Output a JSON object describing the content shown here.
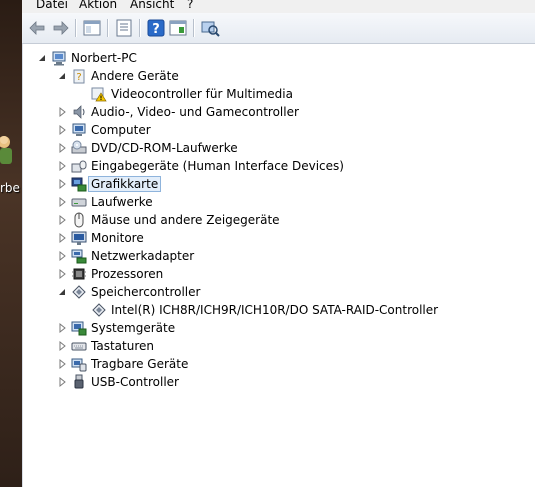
{
  "desktop": {
    "label": "rbe"
  },
  "menu": [
    "Datei",
    "Aktion",
    "Ansicht",
    "?"
  ],
  "toolbar": [
    "back-icon",
    "forward-icon",
    "show-hide-tree-icon",
    "properties-icon",
    "help-icon",
    "view-icon",
    "scan-hardware-icon"
  ],
  "tree": {
    "root": "Norbert-PC",
    "items": [
      {
        "label": "Andere Geräte",
        "icon": "unknown-device-icon",
        "expanded": true,
        "children": [
          {
            "label": "Videocontroller für Multimedia",
            "icon": "warning-device-icon"
          }
        ]
      },
      {
        "label": "Audio-, Video- und Gamecontroller",
        "icon": "speaker-icon"
      },
      {
        "label": "Computer",
        "icon": "computer-icon"
      },
      {
        "label": "DVD/CD-ROM-Laufwerke",
        "icon": "dvd-drive-icon"
      },
      {
        "label": "Eingabegeräte (Human Interface Devices)",
        "icon": "hid-icon"
      },
      {
        "label": "Grafikkarte",
        "icon": "display-adapter-icon",
        "selected": true
      },
      {
        "label": "Laufwerke",
        "icon": "disk-drive-icon"
      },
      {
        "label": "Mäuse und andere Zeigegeräte",
        "icon": "mouse-icon"
      },
      {
        "label": "Monitore",
        "icon": "monitor-icon"
      },
      {
        "label": "Netzwerkadapter",
        "icon": "network-adapter-icon"
      },
      {
        "label": "Prozessoren",
        "icon": "processor-icon"
      },
      {
        "label": "Speichercontroller",
        "icon": "storage-controller-icon",
        "expanded": true,
        "children": [
          {
            "label": "Intel(R) ICH8R/ICH9R/ICH10R/DO SATA-RAID-Controller",
            "icon": "storage-controller-icon"
          }
        ]
      },
      {
        "label": "Systemgeräte",
        "icon": "system-device-icon"
      },
      {
        "label": "Tastaturen",
        "icon": "keyboard-icon"
      },
      {
        "label": "Tragbare Geräte",
        "icon": "portable-device-icon"
      },
      {
        "label": "USB-Controller",
        "icon": "usb-icon"
      }
    ]
  },
  "colors": {
    "selection": "#e3eefa",
    "selection_border": "#8fb4dc",
    "toolbar": "#e6ebf2"
  }
}
